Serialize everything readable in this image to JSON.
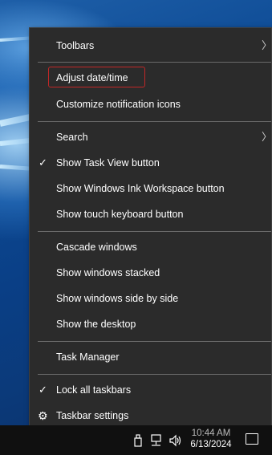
{
  "context_menu": {
    "items": [
      {
        "label": "Toolbars",
        "has_submenu": true,
        "checked": false
      },
      {
        "label": "Adjust date/time",
        "has_submenu": false,
        "checked": false,
        "highlighted": true
      },
      {
        "label": "Customize notification icons",
        "has_submenu": false,
        "checked": false
      },
      {
        "label": "Search",
        "has_submenu": true,
        "checked": false
      },
      {
        "label": "Show Task View button",
        "has_submenu": false,
        "checked": true
      },
      {
        "label": "Show Windows Ink Workspace button",
        "has_submenu": false,
        "checked": false
      },
      {
        "label": "Show touch keyboard button",
        "has_submenu": false,
        "checked": false
      },
      {
        "label": "Cascade windows",
        "has_submenu": false,
        "checked": false
      },
      {
        "label": "Show windows stacked",
        "has_submenu": false,
        "checked": false
      },
      {
        "label": "Show windows side by side",
        "has_submenu": false,
        "checked": false
      },
      {
        "label": "Show the desktop",
        "has_submenu": false,
        "checked": false
      },
      {
        "label": "Task Manager",
        "has_submenu": false,
        "checked": false
      },
      {
        "label": "Lock all taskbars",
        "has_submenu": false,
        "checked": true
      },
      {
        "label": "Taskbar settings",
        "has_submenu": false,
        "checked": false,
        "icon": "gear-icon"
      }
    ],
    "check_glyph": "✓",
    "submenu_glyph": "〉",
    "gear_glyph": "⚙",
    "highlight_color": "#c22727"
  },
  "taskbar": {
    "clock_time": "10:44 AM",
    "clock_date": "6/13/2024",
    "tray_icons": [
      "usb-icon",
      "network-icon",
      "volume-icon"
    ],
    "notification_icon": "action-center-icon"
  }
}
